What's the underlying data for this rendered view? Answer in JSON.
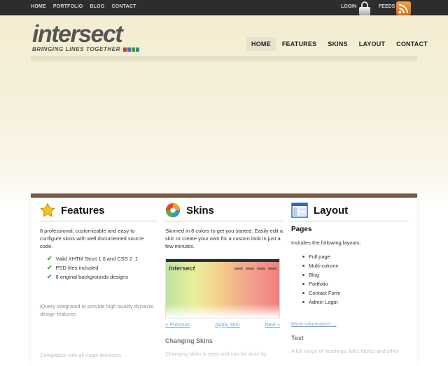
{
  "topbar": {
    "nav": [
      "HOME",
      "PORTFOLIO",
      "BLOG",
      "CONTACT"
    ],
    "login": "LOGIN",
    "feeds": "FEEDS"
  },
  "logo": {
    "word": "intersect",
    "tagline": "BRINGING LINES TOGETHER",
    "stripe_colors": [
      "#d33b2c",
      "#3f6fb5",
      "#3c9a3c",
      "#2a8f8a"
    ]
  },
  "mainnav": [
    "HOME",
    "FEATURES",
    "SKINS",
    "LAYOUT",
    "CONTACT"
  ],
  "features": {
    "title": "Features",
    "intro": "8 professional, customizable and easy to configure skins with well documented source code.",
    "checks": [
      "Valid XHTM Strict 1.0 and CSS 2 .1",
      "PSD files included",
      "8 original backgrounds designs"
    ],
    "jquery": "jQuery integrated to provide high quality dynamic design features",
    "faded_text": "Compatible with all major browsers"
  },
  "skins": {
    "title": "Skins",
    "intro": "Skinned in 8 colors to get you started. Easily edit a skin or create your own for a custom look in just a few minutes.",
    "thumb_logo": "intersect",
    "prev": "« Previous",
    "apply": "Apply Skin",
    "next": "Next »",
    "subhead": "Changing Skins",
    "faded_text": "Changing skins is easy and can be done by"
  },
  "layout": {
    "title": "Layout",
    "pages_title": "Pages",
    "intro": "Includes the following layouts:",
    "items": [
      "Full page",
      "Multi-column",
      "Blog",
      "Portfolio",
      "Contact Form",
      "Admin Login"
    ],
    "more": "More information ...",
    "subhead": "Text",
    "faded_text": "A full range of headings, lists, tables and other"
  }
}
